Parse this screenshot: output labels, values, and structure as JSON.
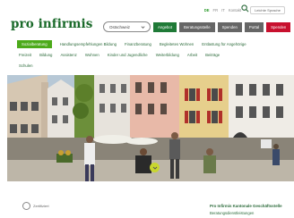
{
  "header": {
    "languages": [
      "DE",
      "FR",
      "IT",
      "Kontakt"
    ],
    "active_language": "DE",
    "header_link": "Leichte Sprache",
    "logo_text": "pro infirmis",
    "select_value": "Ostschweiz",
    "buttons": [
      {
        "label": "Angebot",
        "color": "#1f7a37"
      },
      {
        "label": "Beratungsstelle",
        "color": "#666666"
      },
      {
        "label": "Spenden",
        "color": "#666666"
      },
      {
        "label": "Portal",
        "color": "#666666"
      },
      {
        "label": "Spenden",
        "color": "#c8102e"
      }
    ]
  },
  "nav": {
    "rows": [
      [
        "Sozialberatung",
        "Handlungsempfehlungen Bildung",
        "Finanzberatung",
        "Begleitetes Wohnen",
        "Entlastung für Angehörige"
      ],
      [
        "Freizeit",
        "Bildung",
        "Assistenz",
        "Wohnen",
        "Kinder und Jugendliche",
        "Weiterbildung",
        "Arbeit",
        "Beiträge"
      ],
      [
        "Schulen"
      ]
    ],
    "active": "Sozialberatung"
  },
  "hero": {
    "image": "street-scene-old-town"
  },
  "footer": {
    "badge_text": "Zertifiziert",
    "title": "Pro Infirmis Kantonale Geschäftsstelle",
    "subtitle": "Beratungsdienstleistungen"
  },
  "colors": {
    "brand_green": "#1f7a37",
    "accent_red": "#c8102e",
    "active_nav": "#4caa1a"
  }
}
